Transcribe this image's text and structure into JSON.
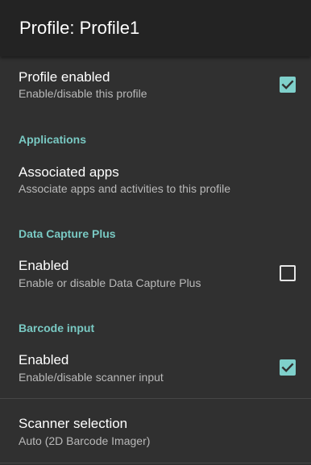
{
  "header": {
    "title": "Profile: Profile1"
  },
  "profile_enabled": {
    "title": "Profile enabled",
    "summary": "Enable/disable this profile",
    "checked": true
  },
  "applications": {
    "category": "Applications",
    "associated_apps": {
      "title": "Associated apps",
      "summary": "Associate apps and activities to this profile"
    }
  },
  "data_capture_plus": {
    "category": "Data Capture Plus",
    "enabled": {
      "title": "Enabled",
      "summary": "Enable or disable Data Capture Plus",
      "checked": false
    }
  },
  "barcode_input": {
    "category": "Barcode input",
    "enabled": {
      "title": "Enabled",
      "summary": "Enable/disable scanner input",
      "checked": true
    },
    "scanner_selection": {
      "title": "Scanner selection",
      "summary": "Auto (2D Barcode Imager)"
    }
  },
  "colors": {
    "accent": "#7fd0cb",
    "category_text": "#79c9c3",
    "background": "#303030",
    "header_background": "#232323"
  }
}
